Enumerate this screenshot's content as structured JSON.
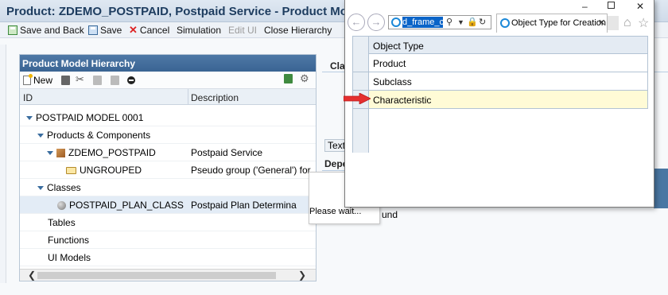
{
  "window": {
    "title": "Product: ZDEMO_POSTPAID, Postpaid Service - Product Model"
  },
  "toolbar": {
    "save_and_back": "Save and Back",
    "save": "Save",
    "cancel": "Cancel",
    "simulation": "Simulation",
    "edit_ui": "Edit UI",
    "close_hierarchy": "Close Hierarchy"
  },
  "hierarchy": {
    "title": "Product Model Hierarchy",
    "new_label": "New",
    "col_id": "ID",
    "col_description": "Description",
    "rows": [
      {
        "id": "POSTPAID MODEL 0001",
        "description": ""
      },
      {
        "id": "Products & Components",
        "description": ""
      },
      {
        "id": "ZDEMO_POSTPAID",
        "description": "Postpaid Service"
      },
      {
        "id": "UNGROUPED",
        "description": "Pseudo group ('General') for"
      },
      {
        "id": "Classes",
        "description": ""
      },
      {
        "id": "POSTPAID_PLAN_CLASS",
        "description": "Postpaid Plan Determina"
      },
      {
        "id": "Tables",
        "description": ""
      },
      {
        "id": "Functions",
        "description": ""
      },
      {
        "id": "UI Models",
        "description": ""
      }
    ]
  },
  "right_area": {
    "label_1": "Cla",
    "text_tab": "Text",
    "label_2": "Depe",
    "under_text": "und"
  },
  "wait_popup": {
    "text": "Please wait..."
  },
  "ie_window": {
    "address_selected": "d_frame_cach",
    "tab_title": "Object Type for Creation",
    "table_header": "Object Type",
    "options": [
      "Product",
      "Subclass",
      "Characteristic"
    ],
    "highlight_color": "#fffbd6",
    "arrow_color": "#e53030"
  }
}
